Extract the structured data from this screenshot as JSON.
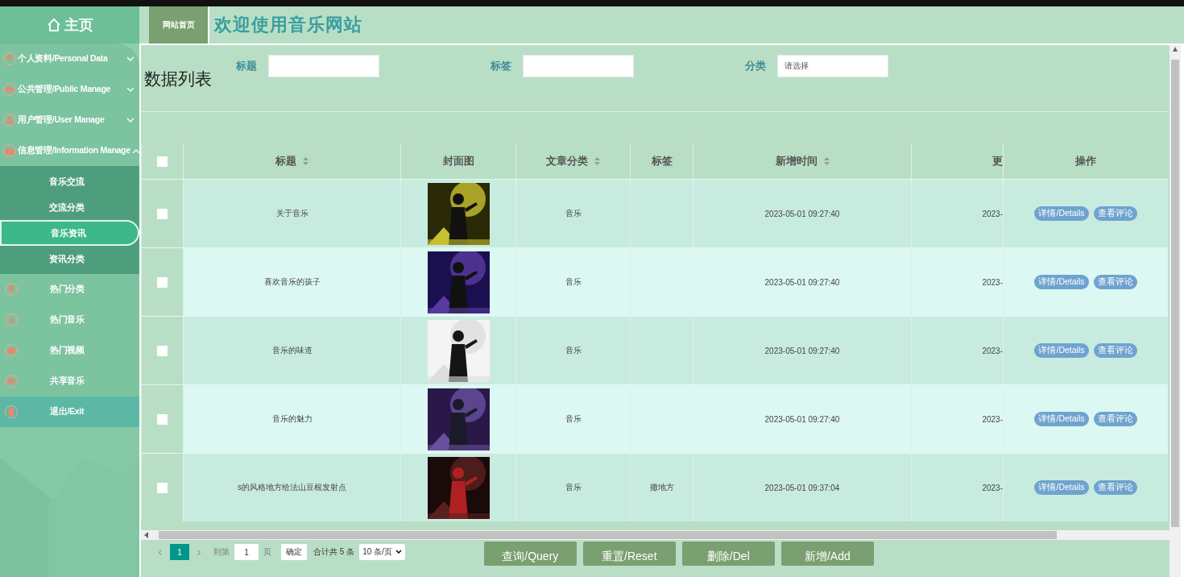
{
  "sidebar": {
    "home": "主页",
    "menu": [
      {
        "label": "个人资料/Personal Data",
        "expanded": false
      },
      {
        "label": "公共管理/Public Manage",
        "expanded": false
      },
      {
        "label": "用户管理/User Manage",
        "expanded": false
      },
      {
        "label": "信息管理/Information Manage",
        "expanded": true,
        "children": [
          {
            "label": "音乐交流",
            "selected": false
          },
          {
            "label": "交流分类",
            "selected": false
          },
          {
            "label": "音乐资讯",
            "selected": true
          },
          {
            "label": "资讯分类",
            "selected": false
          }
        ]
      },
      {
        "label": "热门分类",
        "kind": "link"
      },
      {
        "label": "热门音乐",
        "kind": "link"
      },
      {
        "label": "热门视频",
        "kind": "link"
      },
      {
        "label": "共享音乐",
        "kind": "link"
      },
      {
        "label": "退出/Exit",
        "kind": "exit"
      }
    ]
  },
  "topbar": {
    "tab": "网站首页",
    "title": "欢迎使用音乐网站"
  },
  "page_title": "数据列表",
  "filters": [
    {
      "label": "标题",
      "kind": "text"
    },
    {
      "label": "标签",
      "kind": "text"
    },
    {
      "label": "分类",
      "kind": "select",
      "placeholder": "请选择"
    }
  ],
  "table": {
    "select_all_checked": false,
    "columns": [
      {
        "label": "标题",
        "sortable": true
      },
      {
        "label": "封面图",
        "sortable": false
      },
      {
        "label": "文章分类",
        "sortable": true
      },
      {
        "label": "标签",
        "sortable": false
      },
      {
        "label": "新增时间",
        "sortable": true
      },
      {
        "label": "更",
        "sortable": false
      },
      {
        "label": "操作",
        "sortable": false
      }
    ],
    "rows": [
      {
        "checked": false,
        "title": "关于音乐",
        "cover": {
          "kind": "picture"
        },
        "category": "音乐",
        "added": "2023-05-01 09:27:40",
        "column_6": "2023-",
        "actions": [
          "详情/Details",
          "查看评论"
        ]
      },
      {
        "checked": false,
        "title": "喜欢音乐的孩子",
        "cover": {
          "kind": "picture"
        },
        "category": "音乐",
        "added": "2023-05-01 09:27:40",
        "column_6": "2023-",
        "actions": [
          "详情/Details",
          "查看评论"
        ]
      },
      {
        "checked": false,
        "title": "音乐的味道",
        "cover": {
          "kind": "picture"
        },
        "category": "音乐",
        "added": "2023-05-01 09:27:40",
        "column_6": "2023-",
        "actions": [
          "详情/Details",
          "查看评论"
        ]
      },
      {
        "checked": false,
        "title": "音乐的魅力",
        "cover": {
          "kind": "picture"
        },
        "category": "音乐",
        "added": "2023-05-01 09:27:40",
        "column_6": "2023-",
        "actions": [
          "详情/Details",
          "查看评论"
        ]
      },
      {
        "checked": false,
        "title": "s的风格地方给法山豆根发射点",
        "cover": {
          "kind": "picture"
        },
        "category": "音乐",
        "tag": "撒地方",
        "added": "2023-05-01 09:37:04",
        "column_6": "2023-",
        "actions": [
          "详情/Details",
          "查看评论"
        ]
      }
    ]
  },
  "pagination": {
    "prev": "‹",
    "pages": [
      {
        "label": "1",
        "selected": true
      }
    ],
    "next": "›",
    "goto_label": "到第",
    "goto_value": "1",
    "page_unit": "页",
    "confirm": "确定",
    "total": "合计共 5 条",
    "page_size": "10 条/页"
  },
  "buttons": [
    "查询/Query",
    "重置/Reset",
    "删除/Del",
    "新增/Add"
  ]
}
